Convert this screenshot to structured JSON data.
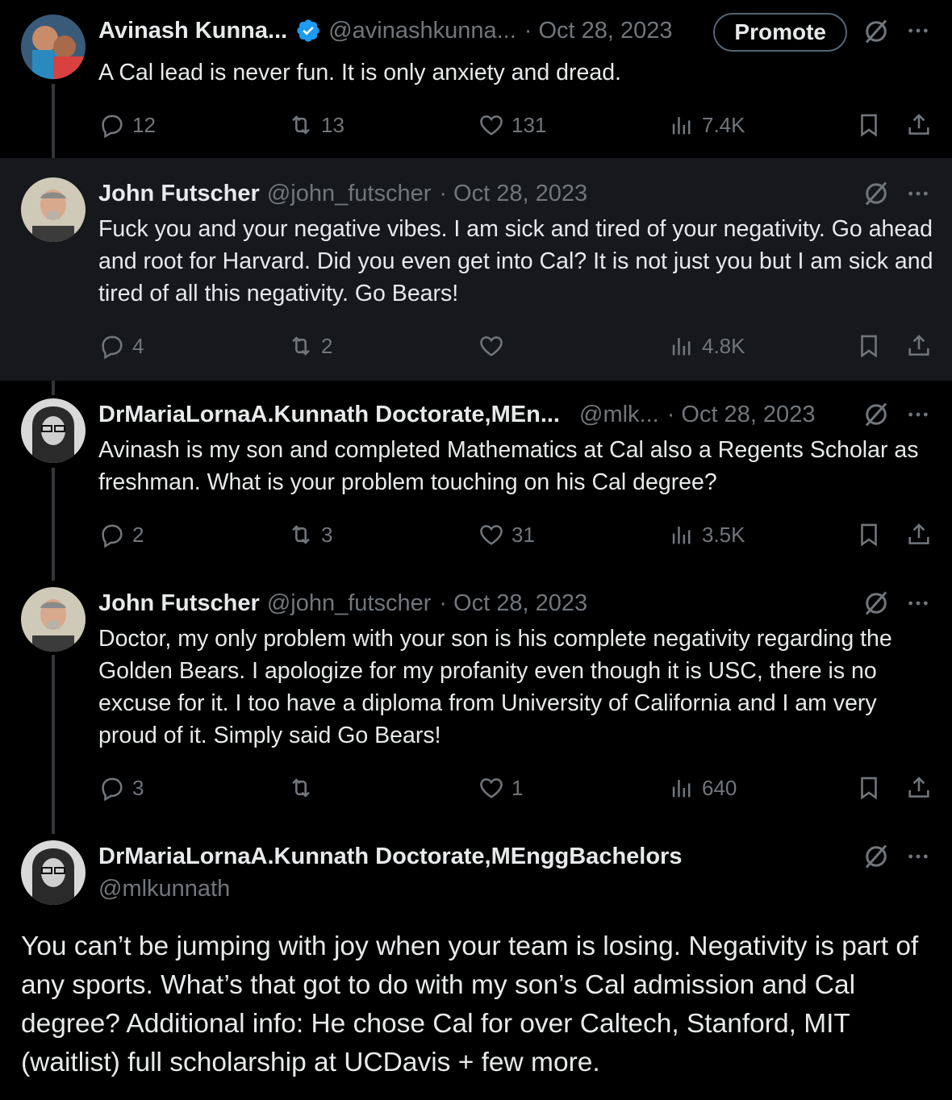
{
  "tweets": [
    {
      "name": "Avinash Kunna...",
      "handle": "@avinashkunna...",
      "date": "Oct 28, 2023",
      "promote_label": "Promote",
      "text": "A Cal lead is never fun. It is only anxiety and dread.",
      "stats": {
        "replies": "12",
        "retweets": "13",
        "likes": "131",
        "views": "7.4K"
      }
    },
    {
      "name": "John Futscher",
      "handle": "@john_futscher",
      "date": "Oct 28, 2023",
      "text": "Fuck you and your negative vibes. I am sick and tired of your negativity. Go ahead and root for Harvard. Did you even get into Cal? It is not just you but I am sick and tired of all this negativity. Go Bears!",
      "stats": {
        "replies": "4",
        "retweets": "2",
        "likes": "",
        "views": "4.8K"
      }
    },
    {
      "name": "DrMariaLornaA.Kunnath Doctorate,MEn...",
      "handle": "@mlk...",
      "date": "Oct 28, 2023",
      "text": "Avinash is my son and completed Mathematics at Cal also a Regents Scholar as freshman. What is your problem touching on his Cal degree?",
      "stats": {
        "replies": "2",
        "retweets": "3",
        "likes": "31",
        "views": "3.5K"
      }
    },
    {
      "name": "John Futscher",
      "handle": "@john_futscher",
      "date": "Oct 28, 2023",
      "text": "Doctor, my only problem with your son is his complete negativity regarding the Golden Bears. I apologize for my profanity even though it is USC, there is no excuse for it. I too have a diploma from University of California and I am very proud of it. Simply said Go Bears!",
      "stats": {
        "replies": "3",
        "retweets": "",
        "likes": "1",
        "views": "640"
      }
    }
  ],
  "main_tweet": {
    "name": "DrMariaLornaA.Kunnath Doctorate,MEnggBachelors",
    "handle": "@mlkunnath",
    "text": "You can’t be jumping with joy when your team is losing. Negativity is part of any sports. What’s that got to do with my son’s Cal admission and Cal degree? Additional info: He chose Cal for over Caltech, Stanford, MIT (waitlist) full scholarship at UCDavis + few more."
  },
  "icons": {
    "verified": "verified-badge-icon",
    "grok": "no-sign-icon",
    "more": "more-dots-icon",
    "reply": "reply-icon",
    "retweet": "retweet-icon",
    "like": "heart-icon",
    "views": "views-chart-icon",
    "bookmark": "bookmark-icon",
    "share": "share-icon"
  },
  "colors": {
    "background": "#000000",
    "highlight_row": "#16181c",
    "text": "#e7e9ea",
    "secondary_text": "#71767b",
    "verified_blue": "#1d9bf0"
  }
}
